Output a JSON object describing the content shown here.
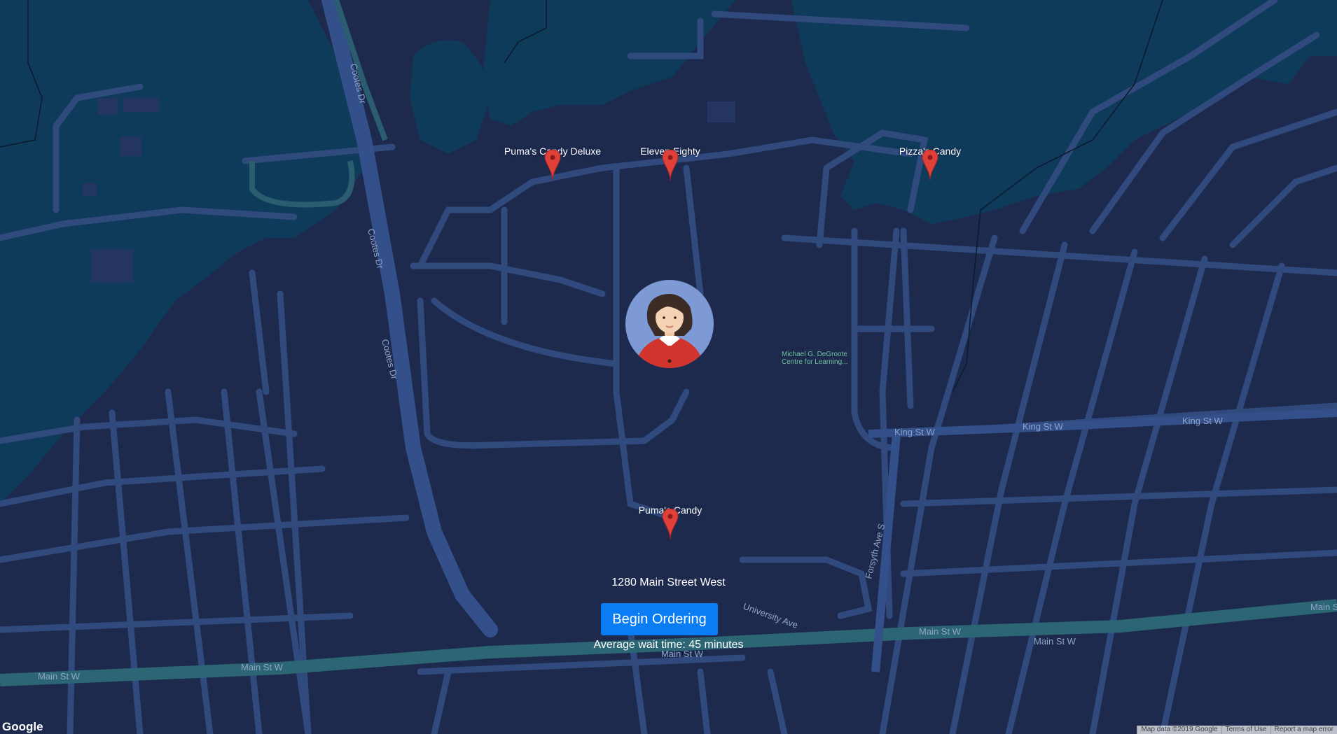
{
  "colors": {
    "land": "#1d2a4d",
    "water": "#0e3b5a",
    "road": "#304a7d",
    "highway": "#2c6675",
    "button": "#0a7cf4"
  },
  "markers": [
    {
      "name": "Puma's Candy Deluxe",
      "icon": "map-pin-icon"
    },
    {
      "name": "Eleven Eighty",
      "icon": "map-pin-icon"
    },
    {
      "name": "Pizza's Candy",
      "icon": "map-pin-icon"
    },
    {
      "name": "Puma's Candy",
      "icon": "map-pin-icon"
    }
  ],
  "user": {
    "avatar_icon": "user-avatar-icon"
  },
  "address": "1280 Main Street West",
  "button": {
    "label": "Begin Ordering"
  },
  "wait_time": "Average wait time: 45 minutes",
  "map_labels": {
    "cootes1": "Cootes Dr",
    "cootes2": "Cootes Dr",
    "cootes3": "Cootes Dr",
    "king1": "King St W",
    "king2": "King St W",
    "king3": "King St W",
    "forsyth": "Forsyth Ave S",
    "university": "University Ave",
    "main1": "Main St W",
    "main2": "Main St W",
    "main3": "Main St W",
    "main4": "Main St W",
    "main5": "Main St W",
    "main6": "Main St W",
    "poi_line1": "Michael G. DeGroote",
    "poi_line2": "Centre for Learning..."
  },
  "footer": {
    "logo": "Google",
    "map_data": "Map data ©2019 Google",
    "terms": "Terms of Use",
    "report": "Report a map error"
  }
}
